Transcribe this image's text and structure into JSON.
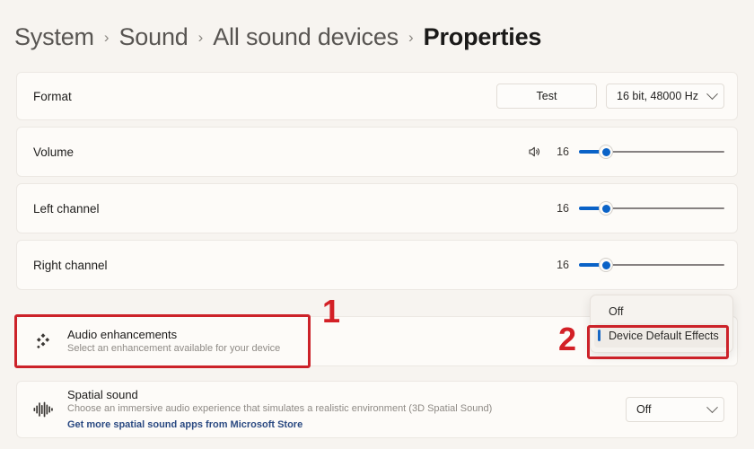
{
  "breadcrumb": {
    "items": [
      {
        "label": "System",
        "current": false
      },
      {
        "label": "Sound",
        "current": false
      },
      {
        "label": "All sound devices",
        "current": false
      },
      {
        "label": "Properties",
        "current": true
      }
    ],
    "separator": "›"
  },
  "rows": {
    "format": {
      "label": "Format",
      "test_button": "Test",
      "value": "16 bit, 48000 Hz"
    },
    "volume": {
      "label": "Volume",
      "icon": "speaker-icon",
      "value": "16"
    },
    "left_channel": {
      "label": "Left channel",
      "value": "16"
    },
    "right_channel": {
      "label": "Right channel",
      "value": "16"
    },
    "audio_enhancements": {
      "icon": "audio-enhancements-icon",
      "title": "Audio enhancements",
      "subtitle": "Select an enhancement available for your device"
    },
    "spatial_sound": {
      "icon": "spatial-sound-icon",
      "title": "Spatial sound",
      "subtitle": "Choose an immersive audio experience that simulates a realistic environment (3D Spatial Sound)",
      "link": "Get more spatial sound apps from Microsoft Store",
      "value": "Off"
    }
  },
  "enhancements_dropdown": {
    "options": [
      {
        "label": "Off",
        "selected": false
      },
      {
        "label": "Device Default Effects",
        "selected": true
      }
    ]
  },
  "annotations": [
    {
      "number": "1",
      "target": "audio-enhancements-row"
    },
    {
      "number": "2",
      "target": "device-default-effects-option"
    }
  ],
  "colors": {
    "accent": "#0a62c7",
    "annotation": "#cc2229",
    "link": "#2b4a82",
    "card": "#fdfbf8",
    "page": "#f7f4f0"
  }
}
